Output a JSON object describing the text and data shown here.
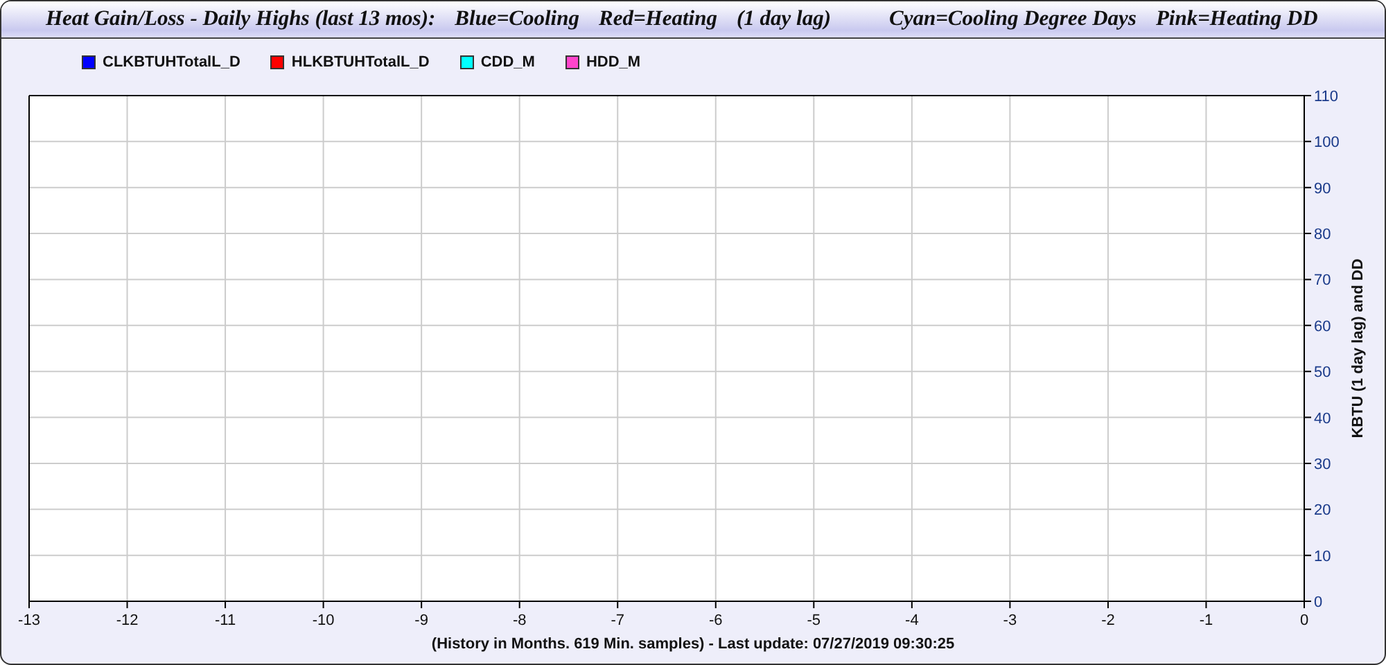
{
  "title_bar": {
    "parts": [
      "Heat Gain/Loss - Daily Highs (last 13 mos):",
      "Blue=Cooling",
      "Red=Heating",
      "(1 day lag)",
      "Cyan=Cooling Degree Days",
      "Pink=Heating DD"
    ]
  },
  "chart": {
    "chart_data": {
      "type": "line",
      "xlabel": "(History in Months. 619 Min. samples) - Last update: 07/27/2019 09:30:25",
      "ylabel": "KBTU (1 day lag) and DD",
      "grid": true,
      "ylim": [
        0,
        110
      ],
      "categories": [
        "-13",
        "-12",
        "-11",
        "-10",
        "-9",
        "-8",
        "-7",
        "-6",
        "-5",
        "-4",
        "-3",
        "-2",
        "-1",
        "0"
      ],
      "yticks": [
        0,
        10,
        20,
        30,
        40,
        50,
        60,
        70,
        80,
        90,
        100,
        110
      ],
      "series": [
        {
          "name": "CLKBTUHTotalL_D",
          "color": "#0000ff",
          "values": [
            null,
            null,
            null,
            null,
            null,
            null,
            null,
            null,
            null,
            null,
            null,
            null,
            null,
            null
          ]
        },
        {
          "name": "HLKBTUHTotalL_D",
          "color": "#ff0000",
          "values": [
            null,
            null,
            null,
            null,
            null,
            null,
            null,
            null,
            null,
            null,
            null,
            null,
            null,
            null
          ]
        },
        {
          "name": "CDD_M",
          "color": "#00ffff",
          "values": [
            null,
            null,
            null,
            null,
            null,
            null,
            null,
            null,
            null,
            null,
            null,
            null,
            null,
            null
          ]
        },
        {
          "name": "HDD_M",
          "color": "#ff44cc",
          "values": [
            null,
            null,
            null,
            null,
            null,
            null,
            null,
            null,
            null,
            null,
            null,
            null,
            null,
            null
          ]
        }
      ]
    }
  }
}
